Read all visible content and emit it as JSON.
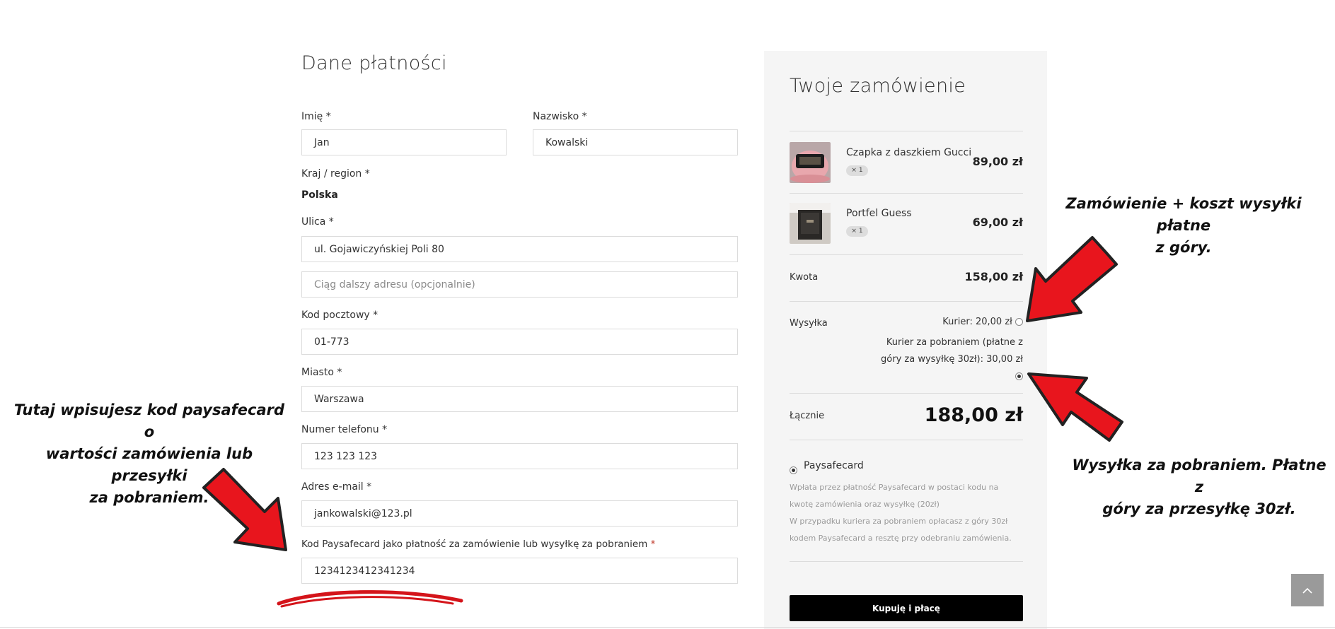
{
  "billing": {
    "title": "Dane płatności",
    "first_name": {
      "label": "Imię",
      "req": "*",
      "value": "Jan"
    },
    "last_name": {
      "label": "Nazwisko",
      "req": "*",
      "value": "Kowalski"
    },
    "country": {
      "label": "Kraj / region",
      "req": "*",
      "value": "Polska"
    },
    "street": {
      "label": "Ulica",
      "req": "*",
      "value": "ul. Gojawiczyńskiej Poli 80",
      "placeholder2": "Ciąg dalszy adresu (opcjonalnie)"
    },
    "postcode": {
      "label": "Kod pocztowy",
      "req": "*",
      "value": "01-773"
    },
    "city": {
      "label": "Miasto",
      "req": "*",
      "value": "Warszawa"
    },
    "phone": {
      "label": "Numer telefonu",
      "req": "*",
      "value": "123 123 123"
    },
    "email": {
      "label": "Adres e-mail",
      "req": "*",
      "value": "jankowalski@123.pl"
    },
    "paysafecard": {
      "label": "Kod Paysafecard jako płatność za zamówienie lub wysyłkę za pobraniem",
      "req": "*",
      "value": "1234123412341234"
    }
  },
  "order": {
    "title": "Twoje zamówienie",
    "items": [
      {
        "name": "Czapka z daszkiem Gucci",
        "qty": "× 1",
        "price": "89,00 zł"
      },
      {
        "name": "Portfel Guess",
        "qty": "× 1",
        "price": "69,00 zł"
      }
    ],
    "subtotal": {
      "label": "Kwota",
      "value": "158,00 zł"
    },
    "shipping": {
      "label": "Wysyłka",
      "option1": "Kurier: 20,00 zł",
      "option2_line1": "Kurier za pobraniem (płatne z",
      "option2_line2": "góry za wysyłkę 30zł): 30,00 zł",
      "selected": 2
    },
    "total": {
      "label": "Łącznie",
      "value": "188,00 zł"
    },
    "payment": {
      "method": "Paysafecard",
      "desc1": "Wpłata przez płatność Paysafecard w postaci kodu na",
      "desc2": "kwotę zamówienia oraz wysyłkę (20zł)",
      "desc3": "W przypadku kuriera za pobraniem opłacasz z góry 30zł",
      "desc4": "kodem Paysafecard a resztę przy odebraniu zamówienia."
    },
    "buy_button": "Kupuję i płacę"
  },
  "annotations": {
    "left_line1": "Tutaj wpisujesz kod paysafecard o",
    "left_line2": "wartości zamówienia lub przesyłki",
    "left_line3": "za pobraniem.",
    "top_right_line1": "Zamówienie + koszt wysyłki płatne",
    "top_right_line2": "z góry.",
    "bottom_right_line1": "Wysyłka za pobraniem. Płatne z",
    "bottom_right_line2": "góry za przesyłkę 30zł."
  },
  "colors": {
    "arrow_red": "#e8151d",
    "arrow_outline": "#222222",
    "button": "#000000",
    "panel": "#f5f5f5"
  },
  "icons": {
    "scroll_top": "chevron-up-icon"
  }
}
